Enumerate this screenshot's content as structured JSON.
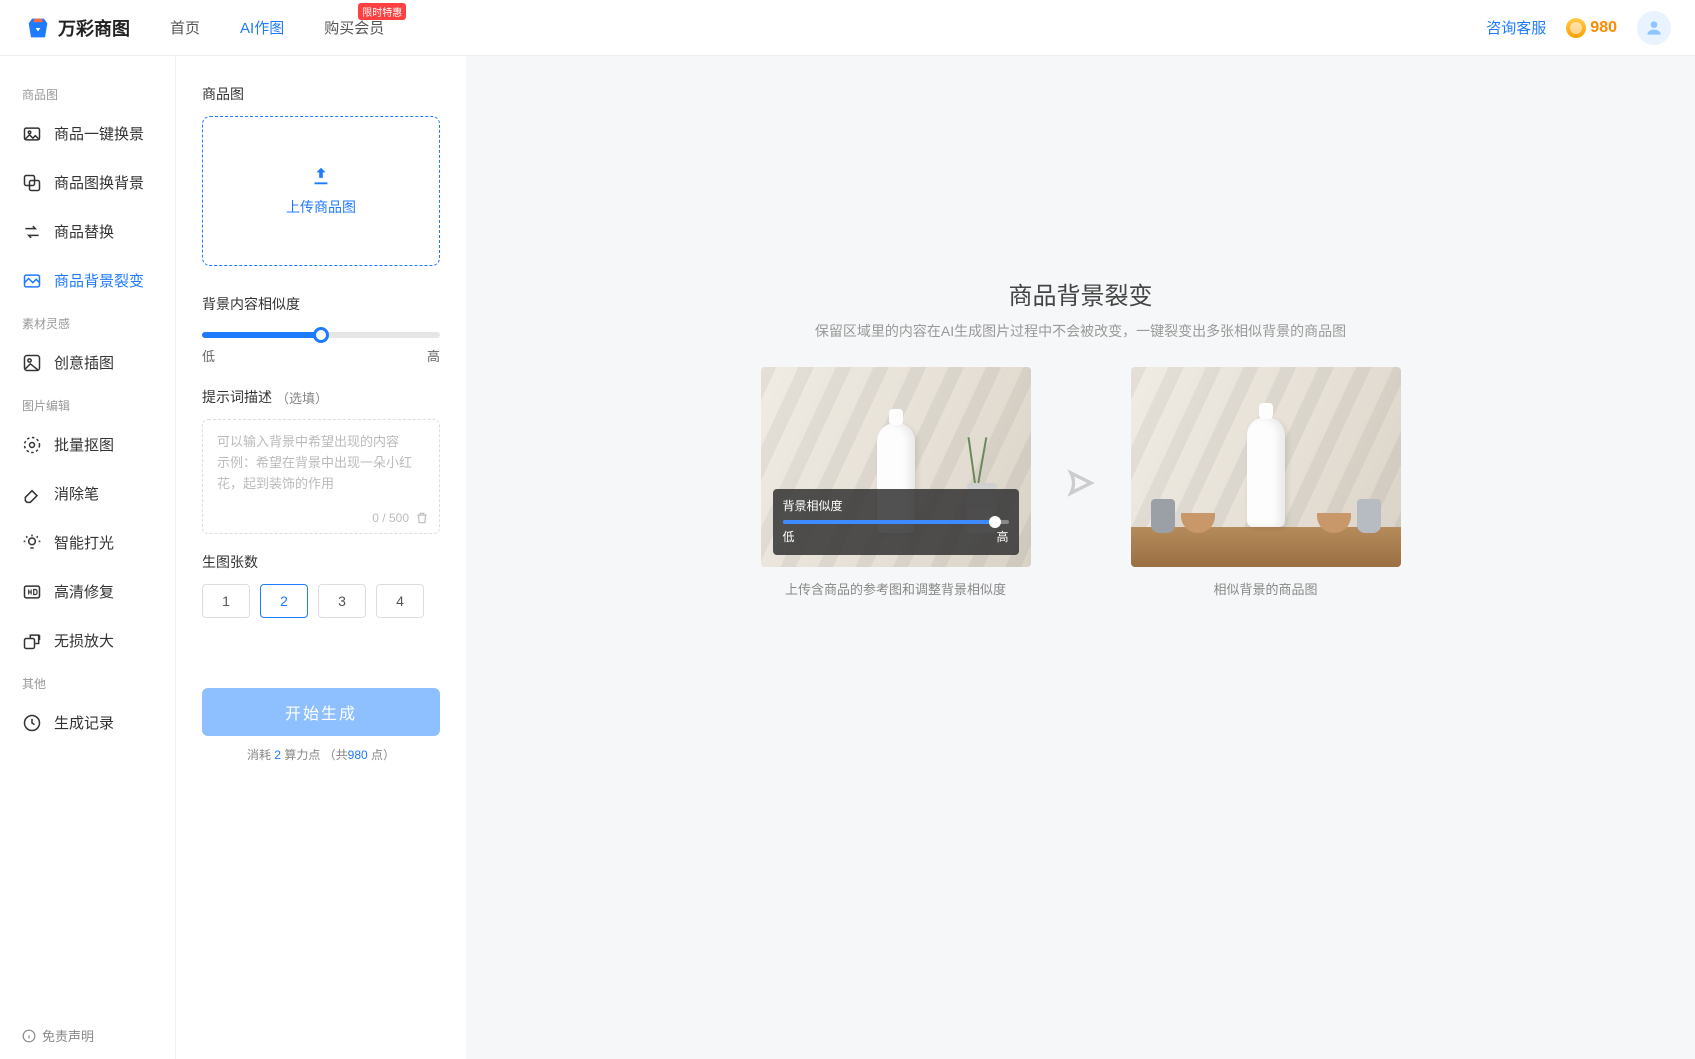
{
  "brand": "万彩商图",
  "header": {
    "nav": [
      "首页",
      "AI作图",
      "购买会员"
    ],
    "active_nav": 1,
    "badge": "限时特惠",
    "support": "咨询客服",
    "credits": "980"
  },
  "sidebar": {
    "groups": [
      {
        "title": "商品图",
        "items": [
          "商品一键换景",
          "商品图换背景",
          "商品替换",
          "商品背景裂变"
        ]
      },
      {
        "title": "素材灵感",
        "items": [
          "创意插图"
        ]
      },
      {
        "title": "图片编辑",
        "items": [
          "批量抠图",
          "消除笔",
          "智能打光",
          "高清修复",
          "无损放大"
        ]
      },
      {
        "title": "其他",
        "items": [
          "生成记录"
        ]
      }
    ],
    "active": "商品背景裂变",
    "disclaimer": "免责声明"
  },
  "panel": {
    "upload_title": "商品图",
    "upload_btn": "上传商品图",
    "slider_title": "背景内容相似度",
    "slider_low": "低",
    "slider_high": "高",
    "prompt_title": "提示词描述",
    "prompt_optional": "（选填）",
    "prompt_placeholder": "可以输入背景中希望出现的内容\n示例：希望在背景中出现一朵小红花，起到装饰的作用",
    "counter": "0 / 500",
    "count_title": "生图张数",
    "count_options": [
      "1",
      "2",
      "3",
      "4"
    ],
    "count_selected": 1,
    "generate": "开始生成",
    "cost_prefix": "消耗 ",
    "cost_value": "2",
    "cost_mid": " 算力点 （共",
    "cost_total": "980",
    "cost_suffix": " 点）"
  },
  "hero": {
    "title": "商品背景裂变",
    "subtitle": "保留区域里的内容在AI生成图片过程中不会被改变，一键裂变出多张相似背景的商品图",
    "cap_left": "上传含商品的参考图和调整背景相似度",
    "cap_right": "相似背景的商品图",
    "overlay_title": "背景相似度",
    "overlay_low": "低",
    "overlay_high": "高"
  }
}
